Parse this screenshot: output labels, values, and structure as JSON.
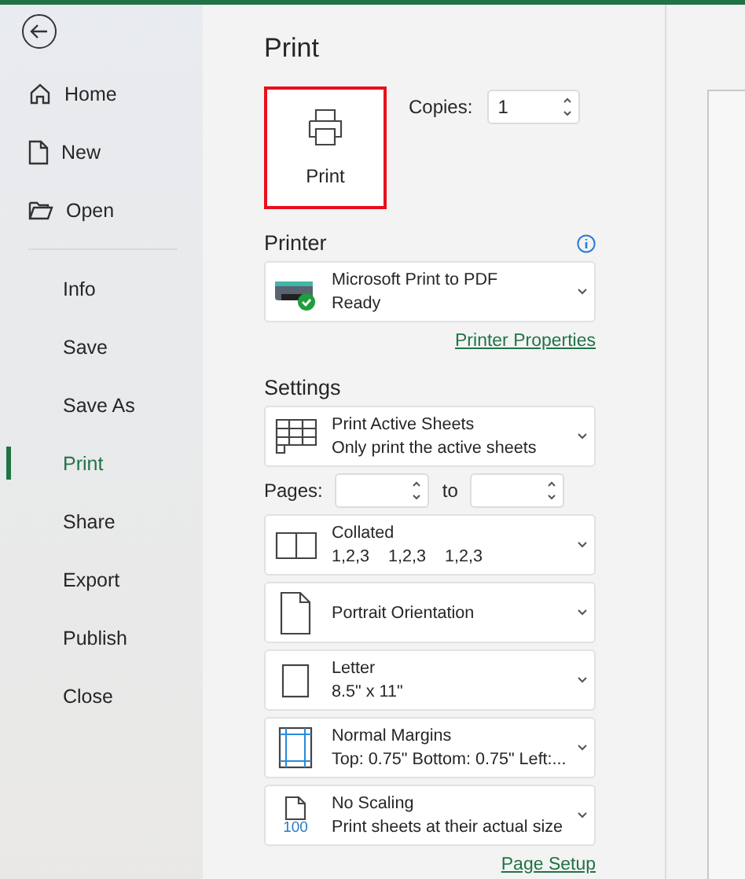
{
  "sidebar": {
    "top_items": [
      {
        "label": "Home",
        "selected": false
      },
      {
        "label": "New",
        "selected": false
      },
      {
        "label": "Open",
        "selected": false
      }
    ],
    "items": [
      {
        "label": "Info",
        "selected": false
      },
      {
        "label": "Save",
        "selected": false
      },
      {
        "label": "Save As",
        "selected": false
      },
      {
        "label": "Print",
        "selected": true
      },
      {
        "label": "Share",
        "selected": false
      },
      {
        "label": "Export",
        "selected": false
      },
      {
        "label": "Publish",
        "selected": false
      },
      {
        "label": "Close",
        "selected": false
      }
    ]
  },
  "title": "Print",
  "print_button": {
    "label": "Print",
    "highlighted": true
  },
  "copies": {
    "label": "Copies:",
    "value": "1"
  },
  "printer": {
    "heading": "Printer",
    "name": "Microsoft Print to PDF",
    "status": "Ready",
    "ready": true,
    "link": "Printer Properties"
  },
  "settings": {
    "heading": "Settings",
    "items": [
      {
        "kind": "dropdown",
        "title": "Print Active Sheets",
        "subtitle": "Only print the active sheets"
      },
      {
        "kind": "range",
        "label": "Pages:",
        "to_label": "to"
      },
      {
        "kind": "dropdown",
        "title": "Collated",
        "subtitle": "1,2,3    1,2,3    1,2,3"
      },
      {
        "kind": "dropdown",
        "title": "Portrait Orientation"
      },
      {
        "kind": "dropdown",
        "title": "Letter",
        "subtitle": "8.5\" x 11\""
      },
      {
        "kind": "dropdown",
        "title": "Normal Margins",
        "subtitle": "Top: 0.75\" Bottom: 0.75\" Left:..."
      },
      {
        "kind": "dropdown",
        "icon_text": "100",
        "title": "No Scaling",
        "subtitle": "Print sheets at their actual size"
      }
    ],
    "link": "Page Setup"
  }
}
